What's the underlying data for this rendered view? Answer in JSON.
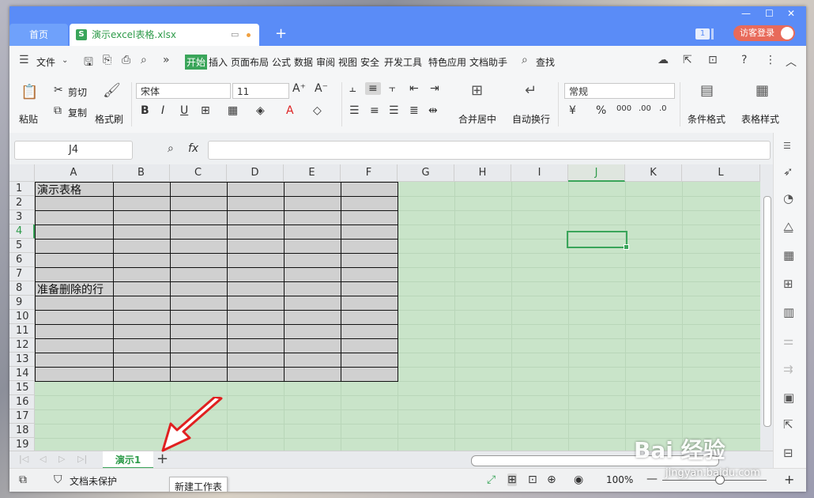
{
  "titlebar": {
    "home_tab": "首页",
    "doc_tab": "演示excel表格.xlsx",
    "new_tab": "+",
    "badge": "1",
    "login": "访客登录"
  },
  "menu": {
    "file": "文件",
    "tabs": [
      "开始",
      "插入",
      "页面布局",
      "公式",
      "数据",
      "审阅",
      "视图",
      "安全",
      "开发工具",
      "特色应用",
      "文档助手"
    ],
    "active": "开始",
    "search": "查找"
  },
  "ribbon": {
    "paste": "粘贴",
    "cut": "剪切",
    "copy": "复制",
    "format_painter": "格式刷",
    "font": "宋体",
    "size": "11",
    "merge": "合并居中",
    "wrap": "自动换行",
    "number_format": "常规",
    "cond_format": "条件格式",
    "table_style": "表格样式"
  },
  "formula_bar": {
    "name_box": "J4",
    "fx": "fx"
  },
  "grid": {
    "columns": [
      "A",
      "B",
      "C",
      "D",
      "E",
      "F",
      "G",
      "H",
      "I",
      "J",
      "K",
      "L"
    ],
    "selected_column": "J",
    "rows": [
      "1",
      "2",
      "3",
      "4",
      "5",
      "6",
      "7",
      "8",
      "9",
      "10",
      "11",
      "12",
      "13",
      "14",
      "15",
      "16",
      "17",
      "18",
      "19"
    ],
    "selected_row": "4",
    "cells": {
      "A1": "演示表格",
      "A8": "准备删除的行"
    }
  },
  "sheets": {
    "active": "演示1",
    "add": "+",
    "tooltip": "新建工作表"
  },
  "status": {
    "protect": "文档未保护",
    "zoom": "100%"
  },
  "watermark": {
    "brand": "Bai  经验",
    "url": "jingyan.baidu.com"
  }
}
